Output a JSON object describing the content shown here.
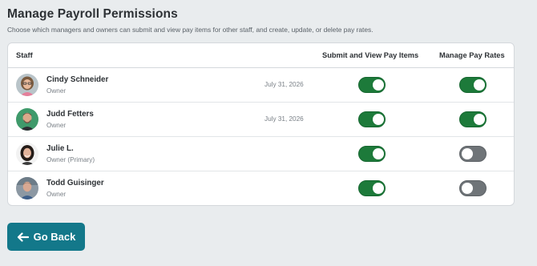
{
  "page": {
    "title": "Manage Payroll Permissions",
    "subtitle": "Choose which managers and owners can submit and view pay items for other staff, and create, update, or delete pay rates."
  },
  "table": {
    "headers": {
      "staff": "Staff",
      "submit_view": "Submit and View Pay Items",
      "manage_rates": "Manage Pay Rates"
    },
    "rows": [
      {
        "name": "Cindy Schneider",
        "role": "Owner",
        "date": "July 31, 2026",
        "submit_view": true,
        "manage_rates": true
      },
      {
        "name": "Judd Fetters",
        "role": "Owner",
        "date": "July 31, 2026",
        "submit_view": true,
        "manage_rates": true
      },
      {
        "name": "Julie L.",
        "role": "Owner (Primary)",
        "date": "",
        "submit_view": true,
        "manage_rates": false
      },
      {
        "name": "Todd Guisinger",
        "role": "Owner",
        "date": "",
        "submit_view": true,
        "manage_rates": false
      }
    ]
  },
  "actions": {
    "back_label": "Go Back",
    "back_icon": "arrow-left-icon"
  },
  "colors": {
    "toggle_on": "#1d7a3a",
    "toggle_off": "#6f7478",
    "primary_button": "#13788a"
  }
}
